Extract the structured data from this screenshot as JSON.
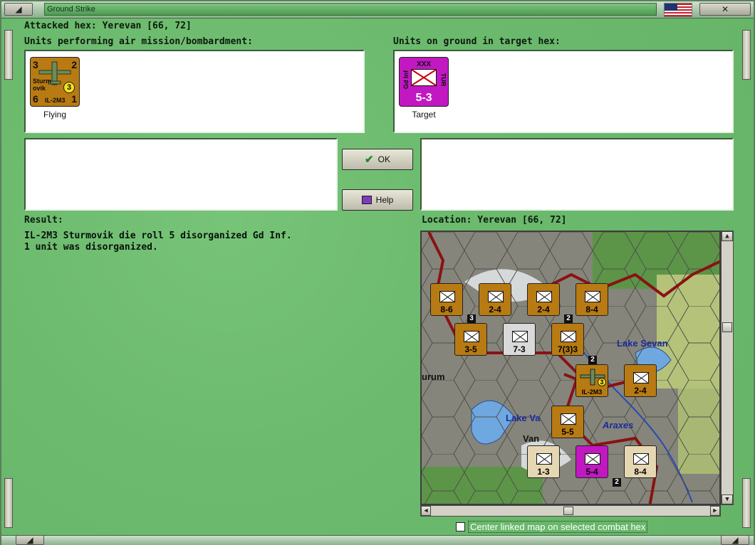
{
  "window": {
    "title": "Ground Strike",
    "colors": {
      "background": "#6cba6e",
      "counter_soviet": "#b87a12",
      "counter_turkey": "#c218c2",
      "border_red": "#8a1212"
    }
  },
  "attacked_hex": "Attacked hex: Yerevan  [66, 72]",
  "air_panel": {
    "label": "Units performing air mission/bombardment:",
    "unit": {
      "top_left": "3",
      "top_right": "2",
      "name_line1": "Sturm",
      "name_line2": "ovik",
      "badge": "3",
      "bottom_left": "6",
      "bottom_right": "1",
      "type": "IL-2M3",
      "caption": "Flying"
    }
  },
  "ground_panel": {
    "label": "Units on ground in target hex:",
    "unit": {
      "size": "XXX",
      "side_left": "Gd Inf",
      "side_right": "TUR",
      "strength": "5-3",
      "caption": "Target"
    }
  },
  "buttons": {
    "ok": "OK",
    "help": "Help"
  },
  "result": {
    "label": "Result:",
    "line1": "IL-2M3 Sturmovik die roll 5 disorganized Gd Inf.",
    "line2": "1 unit was disorganized."
  },
  "location": "Location:  Yerevan  [66, 72]",
  "map": {
    "labels": {
      "lake_sevan": "Lake Sevan",
      "lake_van": "Lake Va",
      "van": "Van",
      "araxes": "Araxes",
      "erzurum": "urum"
    },
    "counters": [
      {
        "size": "XXXX",
        "strength": "8-6",
        "color": "#b87a12"
      },
      {
        "size": "XXX",
        "strength": "2-4",
        "color": "#b87a12"
      },
      {
        "size": "XX",
        "strength": "2-4",
        "color": "#b87a12"
      },
      {
        "size": "XXXX",
        "strength": "8-4",
        "color": "#b87a12"
      },
      {
        "size": "XXX",
        "strength": "3-5",
        "color": "#b87a12"
      },
      {
        "size": "XXX",
        "strength": "7-3",
        "color": "#d9d9d9"
      },
      {
        "size": "XXXXX",
        "strength": "7(3)3",
        "color": "#b87a12"
      },
      {
        "size": "XX",
        "strength": "2-4",
        "color": "#b87a12"
      },
      {
        "size": "XXX",
        "strength": "5-5",
        "color": "#b87a12"
      },
      {
        "size": "XX",
        "strength": "1-3",
        "color": "#e6d7b3"
      },
      {
        "size": "XXX",
        "strength": "5-4",
        "color": "#c218c2"
      },
      {
        "size": "XXX",
        "strength": "8-4",
        "color": "#e6d7b3"
      }
    ],
    "stack_badges": [
      "3",
      "2",
      "2",
      "2"
    ]
  },
  "checkbox": {
    "label": "Center linked map on selected combat hex",
    "checked": false
  }
}
